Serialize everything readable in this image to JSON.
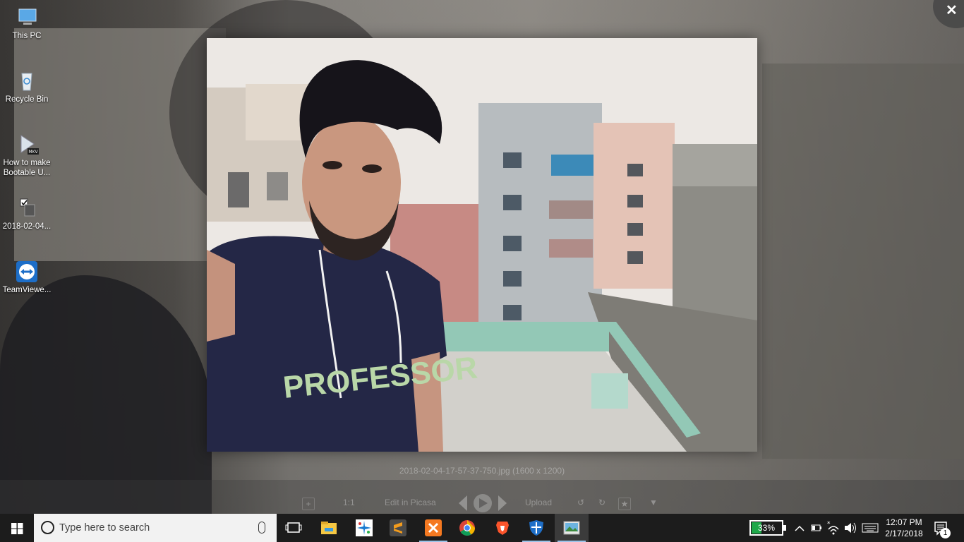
{
  "desktop": {
    "icons": [
      {
        "label": "This PC",
        "icon": "this-pc-icon"
      },
      {
        "label": "Recycle Bin",
        "icon": "recycle-bin-icon"
      },
      {
        "label": "How to make Bootable U...",
        "icon": "mkv-video-icon",
        "badge": "MKV"
      },
      {
        "label": "2018-02-04...",
        "icon": "image-file-icon"
      },
      {
        "label": "TeamViewe...",
        "icon": "teamviewer-icon"
      }
    ]
  },
  "viewer": {
    "caption": "2018-02-04-17-57-37-750.jpg (1600 x 1200)",
    "photo_shirt_text": "PROFESSOR",
    "toolbar": {
      "zoom_in_label": "+",
      "actual_size_label": "1:1",
      "edit_label": "Edit in Picasa",
      "upload_label": "Upload",
      "star_label": "★",
      "more_label": "▼"
    }
  },
  "taskbar": {
    "search_placeholder": "Type here to search",
    "apps": [
      "task-view",
      "file-explorer",
      "teamviewer-qs",
      "sublime-text",
      "xampp",
      "chrome",
      "brave",
      "windows-defender",
      "photo-viewer"
    ],
    "battery_percent": "33%",
    "battery_level": 0.33,
    "time": "12:07 PM",
    "date": "2/17/2018",
    "notification_count": "1"
  },
  "colors": {
    "taskbar_bg": "#1c1c1c",
    "search_bg": "#f2f2f2",
    "battery_green": "#1fa84a",
    "active_indicator": "#9cc3e8"
  }
}
